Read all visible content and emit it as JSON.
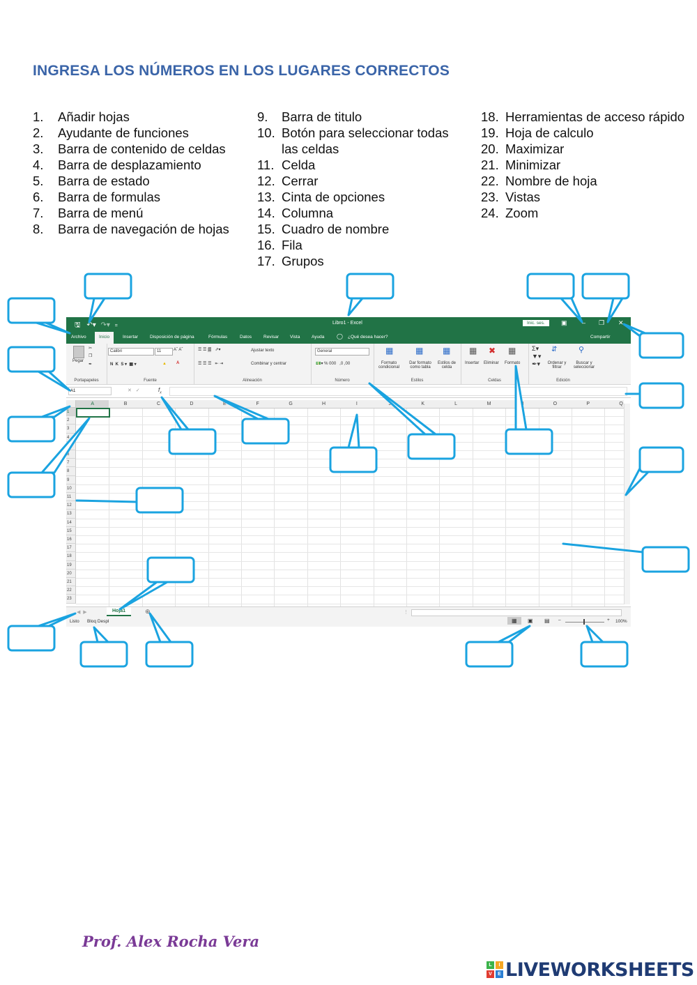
{
  "worksheet_title": "INGRESA LOS NÚMEROS EN LOS LUGARES CORRECTOS",
  "terms_col1": [
    {
      "num": "1.",
      "text": "Añadir hojas"
    },
    {
      "num": "2.",
      "text": "Ayudante de funciones"
    },
    {
      "num": "3.",
      "text": "Barra de contenido de celdas"
    },
    {
      "num": "4.",
      "text": "Barra de desplazamiento"
    },
    {
      "num": "5.",
      "text": "Barra de estado"
    },
    {
      "num": "6.",
      "text": "Barra de formulas"
    },
    {
      "num": "7.",
      "text": "Barra de menú"
    },
    {
      "num": "8.",
      "text": "Barra de navegación de hojas"
    }
  ],
  "terms_col2": [
    {
      "num": "9.",
      "text": "Barra de titulo"
    },
    {
      "num": "10.",
      "text": "Botón para seleccionar todas las celdas"
    },
    {
      "num": "11.",
      "text": "Celda"
    },
    {
      "num": "12.",
      "text": "Cerrar"
    },
    {
      "num": "13.",
      "text": "Cinta de opciones"
    },
    {
      "num": "14.",
      "text": "Columna"
    },
    {
      "num": "15.",
      "text": "Cuadro de nombre"
    },
    {
      "num": "16.",
      "text": "Fila"
    },
    {
      "num": "17.",
      "text": "Grupos"
    }
  ],
  "terms_col3": [
    {
      "num": "18.",
      "text": "Herramientas de acceso rápido"
    },
    {
      "num": "19.",
      "text": "Hoja de calculo"
    },
    {
      "num": "20.",
      "text": "Maximizar"
    },
    {
      "num": "21.",
      "text": "Minimizar"
    },
    {
      "num": "22.",
      "text": "Nombre de hoja"
    },
    {
      "num": "23.",
      "text": "Vistas"
    },
    {
      "num": "24.",
      "text": "Zoom"
    }
  ],
  "excel": {
    "window_title": "Libro1 - Excel",
    "signin": "Inic. ses.",
    "tabs": [
      "Archivo",
      "Inicio",
      "Insertar",
      "Disposición de página",
      "Fórmulas",
      "Datos",
      "Revisar",
      "Vista",
      "Ayuda"
    ],
    "tell_me": "¿Qué desea hacer?",
    "share": "Compartir",
    "ribbon": {
      "paste": "Pegar",
      "font_name": "Calibri",
      "font_size": "11",
      "wrap_text": "Ajustar texto",
      "merge_center": "Combinar y centrar",
      "number_format": "General",
      "cond_format": "Formato condicional",
      "format_table": "Dar formato como tabla",
      "cell_styles": "Estilos de celda",
      "insert": "Insertar",
      "delete": "Eliminar",
      "format": "Formato",
      "sort_filter": "Ordenar y filtrar",
      "find_select": "Buscar y seleccionar",
      "groups": [
        "Portapapeles",
        "Fuente",
        "Alineación",
        "Número",
        "Estilos",
        "Celdas",
        "Edición"
      ]
    },
    "name_box": "A1",
    "columns": [
      "A",
      "B",
      "C",
      "D",
      "E",
      "F",
      "G",
      "H",
      "I",
      "J",
      "K",
      "L",
      "M",
      "N",
      "O",
      "P",
      "Q"
    ],
    "rows": [
      "1",
      "2",
      "3",
      "4",
      "5",
      "6",
      "7",
      "8",
      "9",
      "10",
      "11",
      "12",
      "13",
      "14",
      "15",
      "16",
      "17",
      "18",
      "19",
      "20",
      "21",
      "22",
      "23"
    ],
    "sheet_name": "Hoja1",
    "status_ready": "Listo",
    "status_scroll": "Bloq Despl",
    "zoom_level": "100%"
  },
  "author": "Prof. Alex Rocha Vera",
  "brand": {
    "letters": [
      "L",
      "I",
      "V",
      "E"
    ],
    "word": "LIVEWORKSHEETS"
  },
  "colors": {
    "title": "#3a64a8",
    "excel_green": "#217346",
    "callout": "#1aa3e0",
    "author": "#7a3a96",
    "brand": "#1f3b73"
  }
}
